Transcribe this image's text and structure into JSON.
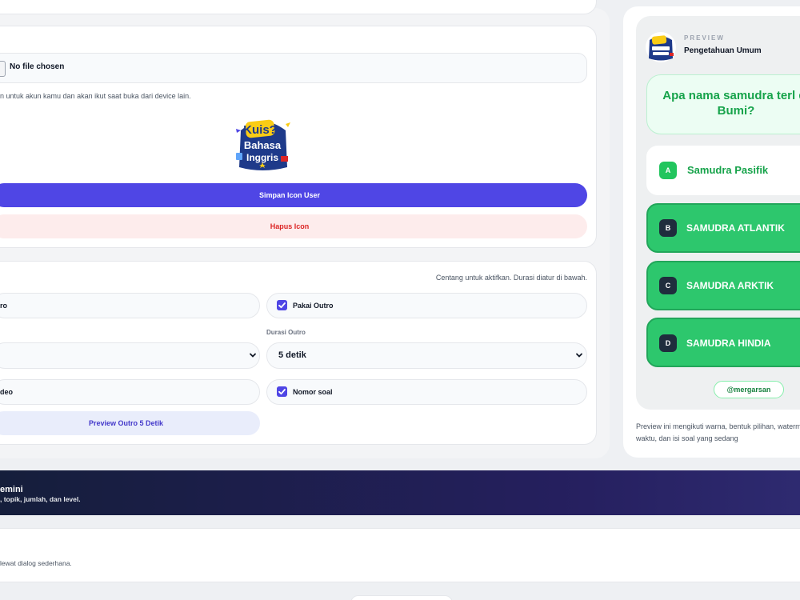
{
  "icon_section": {
    "file_status": "No file chosen",
    "helper_text": "n untuk akun kamu dan akan ikut saat buka dari device lain.",
    "logo": {
      "line1": "Kuis?",
      "line2": "Bahasa",
      "line3": "Inggris"
    },
    "save_button": "Simpan Icon User",
    "delete_button": "Hapus Icon"
  },
  "outro_section": {
    "hint": "Centang untuk aktifkan. Durasi diatur di bawah.",
    "intro_label": "ro",
    "outro_checkbox_label": "Pakai Outro",
    "outro_checked": true,
    "duration_label": "Durasi Outro",
    "duration_value": "5 detik",
    "video_label": "deo",
    "nomor_checkbox_label": "Nomor soal",
    "nomor_checked": true,
    "preview_button": "Preview Outro 5 Detik"
  },
  "preview": {
    "label": "PREVIEW",
    "title": "Pengetahuan Umum",
    "question": "Apa nama samudra terl di Bumi?",
    "options": [
      {
        "key": "A",
        "text": "Samudra Pasifik"
      },
      {
        "key": "B",
        "text": "SAMUDRA ATLANTIK"
      },
      {
        "key": "C",
        "text": "SAMUDRA ARKTIK"
      },
      {
        "key": "D",
        "text": "SAMUDRA HINDIA"
      }
    ],
    "watermark": "@mergarsan",
    "note": "Preview ini mengikuti warna, bentuk pilihan, watermark, waktu, dan isi soal yang sedang"
  },
  "gemini": {
    "title": "emini",
    "subtitle": ", topik, jumlah, dan level."
  },
  "bottom": {
    "text": "lewat dialog sederhana."
  },
  "colors": {
    "accent": "#4f46e5",
    "correct": "#22c55e",
    "option_green": "#2dc76d",
    "danger": "#dc2626"
  }
}
